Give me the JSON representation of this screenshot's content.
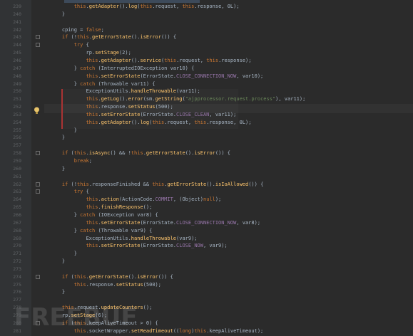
{
  "editor": {
    "lines": [
      {
        "n": "239",
        "text": "        this.getAdapter().log(this.request, this.response, 0L);",
        "tokens": "mix"
      },
      {
        "n": "240",
        "text": "    }",
        "tokens": "plain"
      },
      {
        "n": "241",
        "text": "",
        "tokens": "plain"
      },
      {
        "n": "242",
        "text": "    cping = false;",
        "tokens": "mix"
      },
      {
        "n": "243",
        "text": "    if (!this.getErrorState().isError()) {",
        "tokens": "mix"
      },
      {
        "n": "244",
        "text": "        try {",
        "tokens": "kw"
      },
      {
        "n": "245",
        "text": "            rp.setStage(2);",
        "tokens": "plain"
      },
      {
        "n": "246",
        "text": "            this.getAdapter().service(this.request, this.response);",
        "tokens": "mix"
      },
      {
        "n": "247",
        "text": "        } catch (InterruptedIOException var10) {",
        "tokens": "mix"
      },
      {
        "n": "248",
        "text": "            this.setErrorState(ErrorState.CLOSE_CONNECTION_NOW, var10);",
        "tokens": "mix"
      },
      {
        "n": "249",
        "text": "        } catch (Throwable var11) {",
        "tokens": "mix"
      },
      {
        "n": "250",
        "text": "            ExceptionUtils.handleThrowable(var11);",
        "tokens": "plain"
      },
      {
        "n": "251",
        "text": "            this.getLog().error(sm.getString(\"ajpprocessor.request.process\"), var11);",
        "tokens": "mix"
      },
      {
        "n": "252",
        "text": "            this.response.setStatus(500);",
        "tokens": "mix"
      },
      {
        "n": "253",
        "text": "            this.setErrorState(ErrorState.CLOSE_CLEAN, var11);",
        "tokens": "mix"
      },
      {
        "n": "254",
        "text": "            this.getAdapter().log(this.request, this.response, 0L);",
        "tokens": "mix"
      },
      {
        "n": "255",
        "text": "        }",
        "tokens": "plain"
      },
      {
        "n": "256",
        "text": "    }",
        "tokens": "plain"
      },
      {
        "n": "257",
        "text": "",
        "tokens": "plain"
      },
      {
        "n": "258",
        "text": "    if (this.isAsync() && !this.getErrorState().isError()) {",
        "tokens": "mix"
      },
      {
        "n": "259",
        "text": "        break;",
        "tokens": "kw"
      },
      {
        "n": "260",
        "text": "    }",
        "tokens": "plain"
      },
      {
        "n": "261",
        "text": "",
        "tokens": "plain"
      },
      {
        "n": "262",
        "text": "    if (!this.responseFinished && this.getErrorState().isIoAllowed()) {",
        "tokens": "mix"
      },
      {
        "n": "263",
        "text": "        try {",
        "tokens": "kw"
      },
      {
        "n": "264",
        "text": "            this.action(ActionCode.COMMIT, (Object)null);",
        "tokens": "mix"
      },
      {
        "n": "265",
        "text": "            this.finishResponse();",
        "tokens": "mix"
      },
      {
        "n": "266",
        "text": "        } catch (IOException var8) {",
        "tokens": "mix"
      },
      {
        "n": "267",
        "text": "            this.setErrorState(ErrorState.CLOSE_CONNECTION_NOW, var8);",
        "tokens": "mix"
      },
      {
        "n": "268",
        "text": "        } catch (Throwable var9) {",
        "tokens": "mix"
      },
      {
        "n": "269",
        "text": "            ExceptionUtils.handleThrowable(var9);",
        "tokens": "plain"
      },
      {
        "n": "270",
        "text": "            this.setErrorState(ErrorState.CLOSE_NOW, var9);",
        "tokens": "mix"
      },
      {
        "n": "271",
        "text": "        }",
        "tokens": "plain"
      },
      {
        "n": "272",
        "text": "    }",
        "tokens": "plain"
      },
      {
        "n": "273",
        "text": "",
        "tokens": "plain"
      },
      {
        "n": "274",
        "text": "    if (this.getErrorState().isError()) {",
        "tokens": "mix"
      },
      {
        "n": "275",
        "text": "        this.response.setStatus(500);",
        "tokens": "mix"
      },
      {
        "n": "276",
        "text": "    }",
        "tokens": "plain"
      },
      {
        "n": "277",
        "text": "",
        "tokens": "plain"
      },
      {
        "n": "278",
        "text": "    this.request.updateCounters();",
        "tokens": "mix"
      },
      {
        "n": "279",
        "text": "    rp.setStage(6);",
        "tokens": "plain"
      },
      {
        "n": "280",
        "text": "    if (this.keepAliveTimeout > 0) {",
        "tokens": "mix"
      },
      {
        "n": "281",
        "text": "        this.socketWrapper.setReadTimeout((long)this.keepAliveTimeout);",
        "tokens": "mix"
      }
    ]
  },
  "colors": {
    "background": "#2b2b2b",
    "keyword": "#cc7832",
    "method": "#ffc66d",
    "string": "#6a8759",
    "constant": "#9876aa",
    "text": "#a9b7c6",
    "line_number": "#606366",
    "error_marker": "#aa3333"
  },
  "icons": {
    "intention": "lightbulb-icon",
    "fold": "fold-marker-icon"
  },
  "watermark_text": "FREEBUF"
}
